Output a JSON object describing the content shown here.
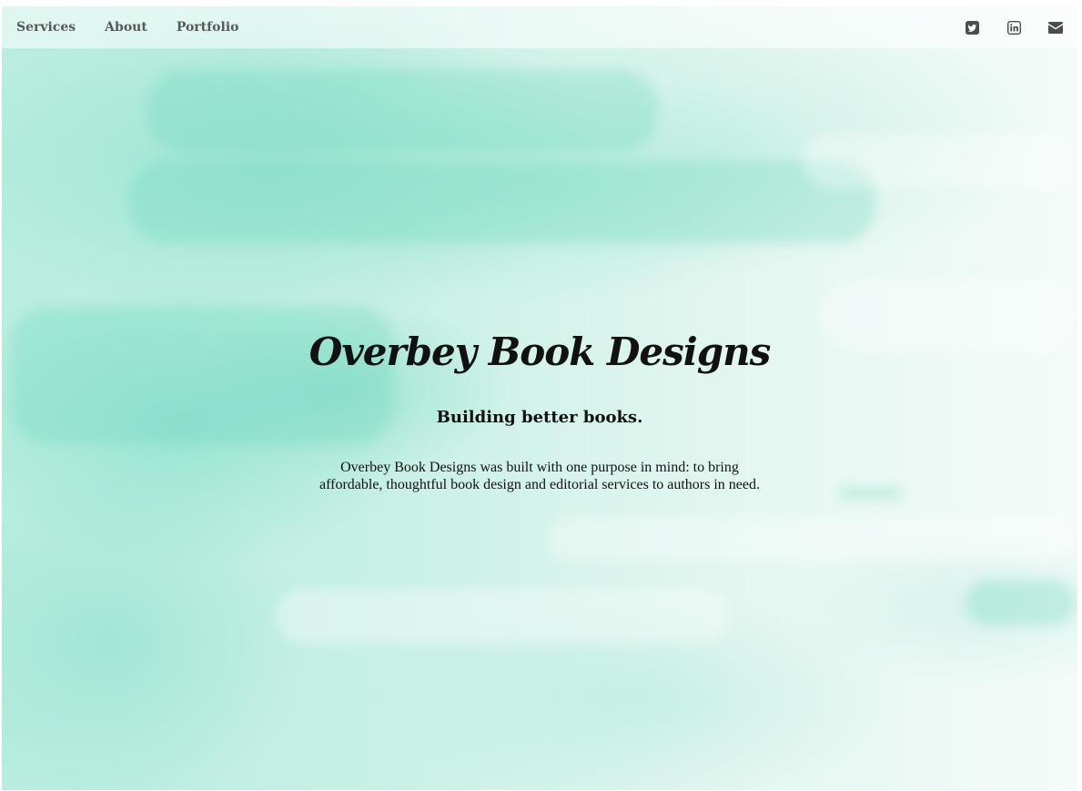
{
  "nav": {
    "links": [
      {
        "label": "Services"
      },
      {
        "label": "About"
      },
      {
        "label": "Portfolio"
      }
    ],
    "social": [
      {
        "icon": "twitter-icon"
      },
      {
        "icon": "linkedin-icon"
      },
      {
        "icon": "envelope-icon"
      }
    ]
  },
  "hero": {
    "title": "Overbey Book Designs",
    "tagline": "Building better books.",
    "body_line1": "Overbey Book Designs was built with one purpose in mind: to bring",
    "body_line2": "affordable, thoughtful book design and editorial services to authors in need."
  },
  "colors": {
    "accent": "#7fdcc4",
    "nav_text": "#555a58",
    "icon": "#4a4e4d",
    "text": "#111111"
  }
}
